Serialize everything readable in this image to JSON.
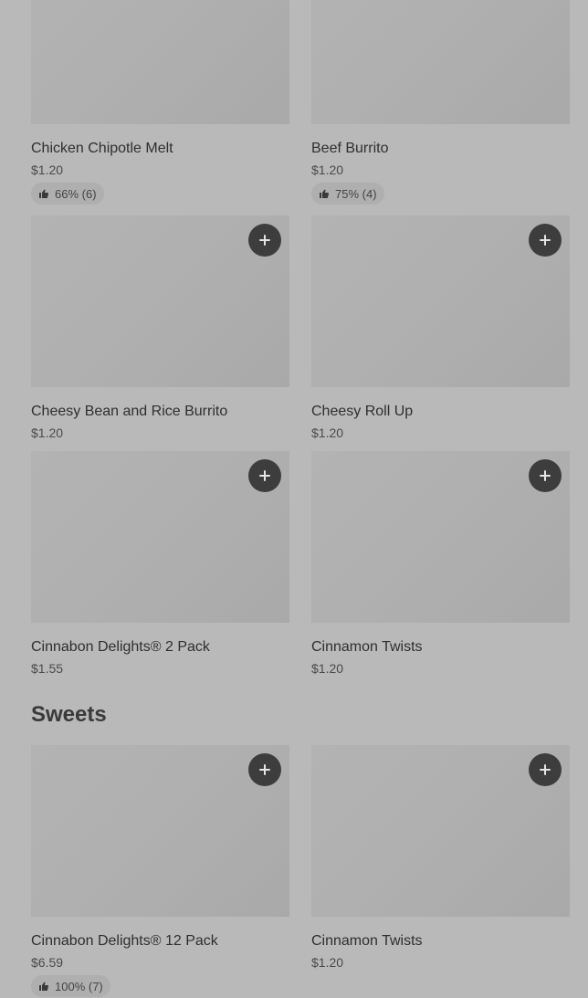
{
  "sections": [
    {
      "title": "",
      "items": [
        {
          "name": "Chicken Chipotle Melt",
          "price": "$1.20",
          "rating": "66% (6)"
        },
        {
          "name": "Beef Burrito",
          "price": "$1.20",
          "rating": "75% (4)"
        },
        {
          "name": "Cheesy Bean and Rice Burrito",
          "price": "$1.20"
        },
        {
          "name": "Cheesy Roll Up",
          "price": "$1.20"
        },
        {
          "name": "Cinnabon Delights® 2 Pack",
          "price": "$1.55"
        },
        {
          "name": "Cinnamon Twists",
          "price": "$1.20"
        }
      ]
    },
    {
      "title": "Sweets",
      "items": [
        {
          "name": "Cinnabon Delights® 12 Pack",
          "price": "$6.59",
          "rating": "100% (7)"
        },
        {
          "name": "Cinnamon Twists",
          "price": "$1.20"
        }
      ]
    }
  ],
  "icons": {
    "add": "plus-icon",
    "rating": "thumbs-up-icon"
  },
  "colors": {
    "page_background": "#b9b9b9",
    "add_button": "#3d3d3d",
    "rating_pill": "#afafaf"
  }
}
